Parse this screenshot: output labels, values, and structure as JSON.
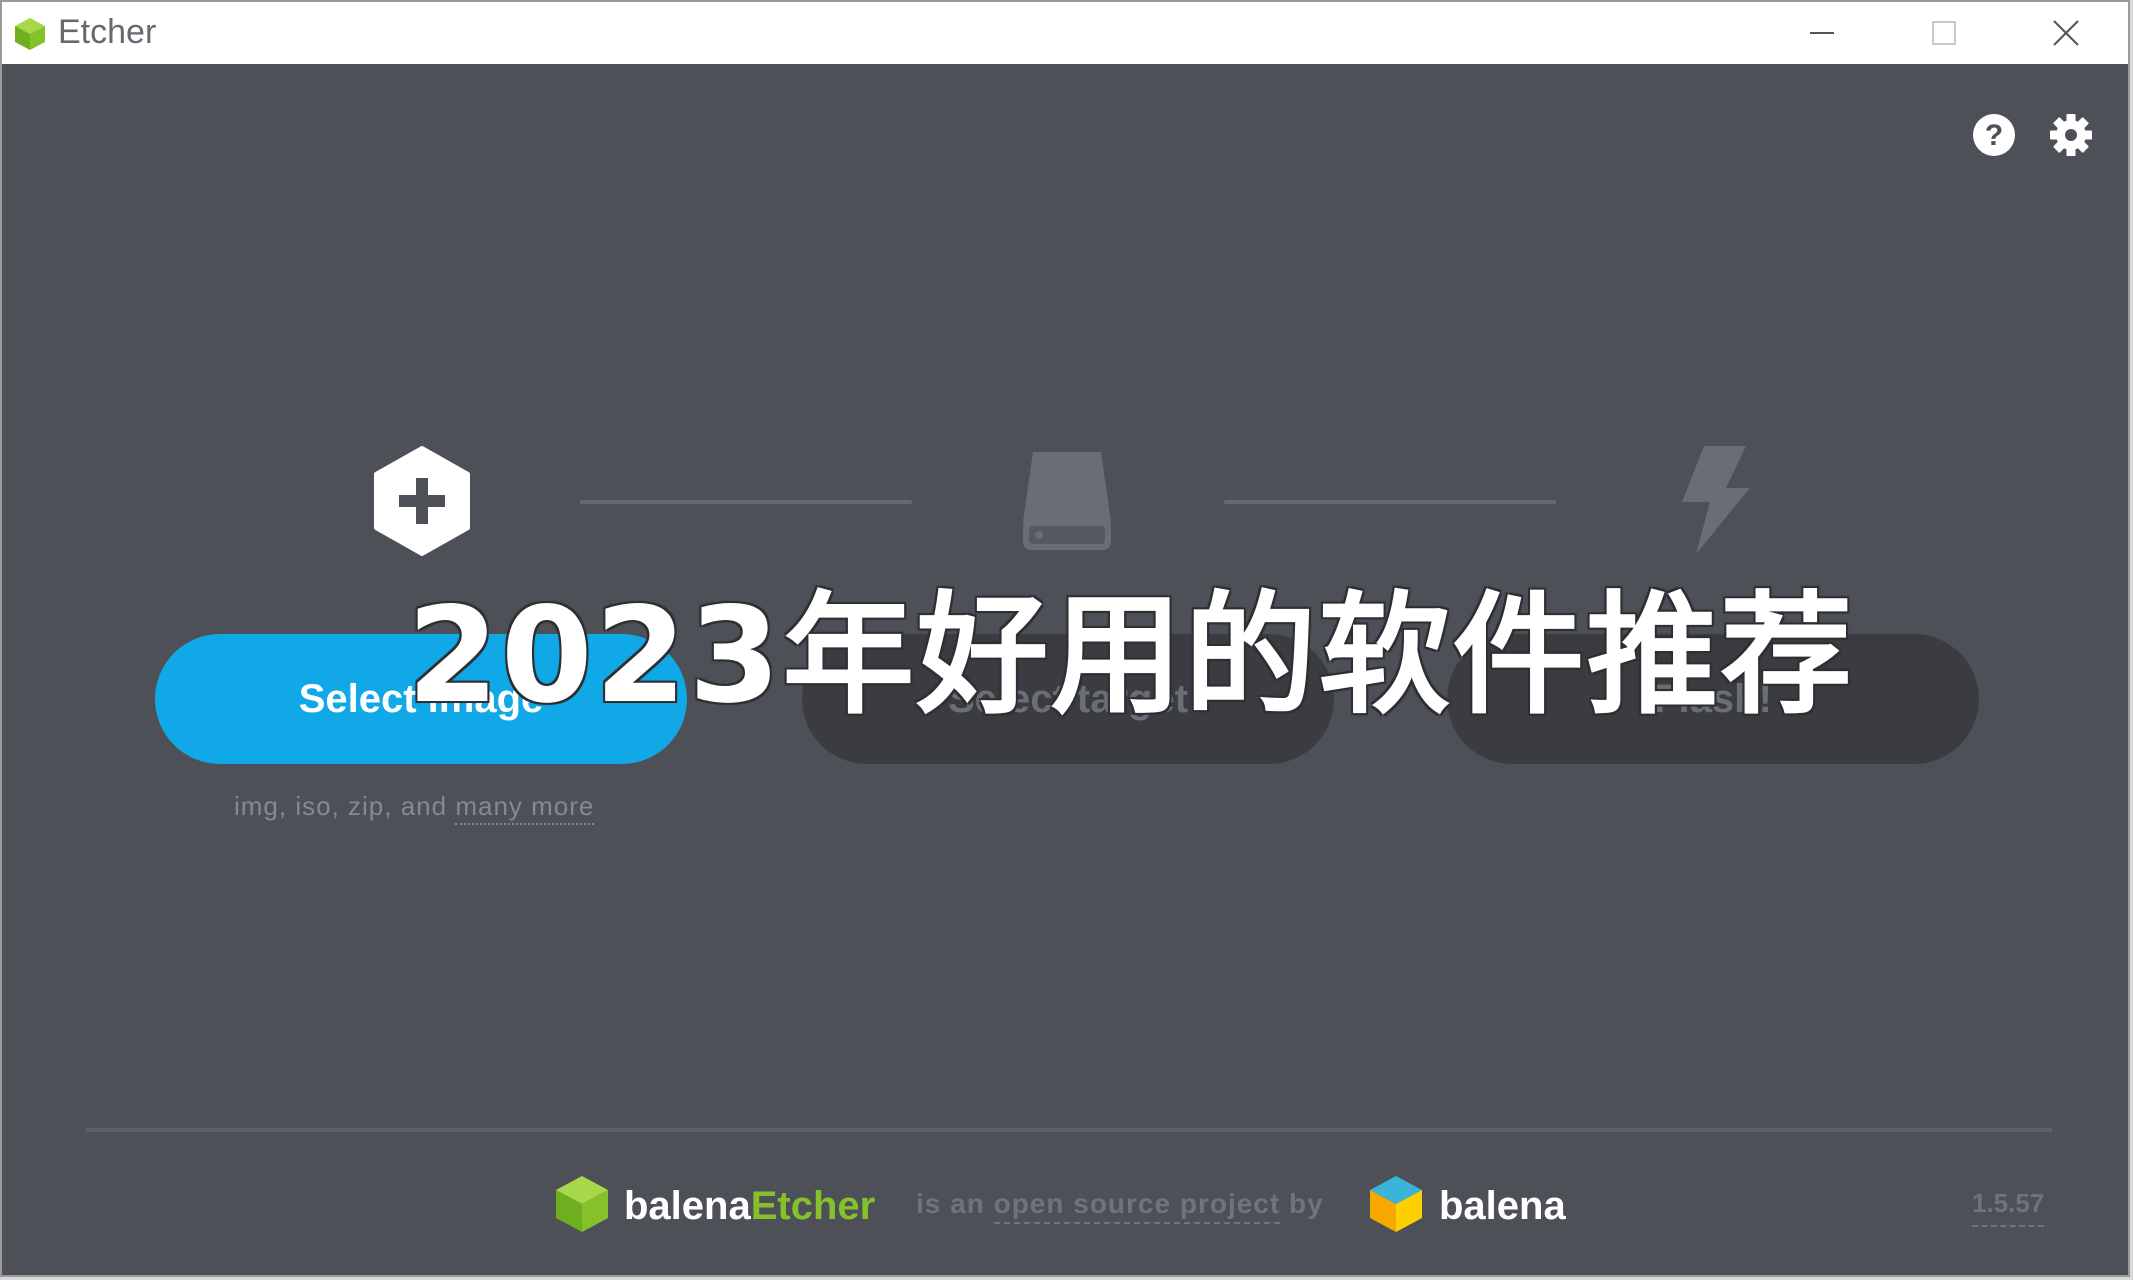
{
  "window": {
    "title": "Etcher",
    "icon": "etcher-cube-icon",
    "controls": [
      "minimize-icon",
      "maximize-icon",
      "close-icon"
    ]
  },
  "header_icons": [
    "help-icon",
    "gear-icon"
  ],
  "steps": [
    {
      "icon": "plus-hexagon-icon",
      "label": "Select image",
      "state": "active"
    },
    {
      "icon": "drive-icon",
      "label": "Select target",
      "state": "disabled"
    },
    {
      "icon": "flash-icon",
      "label": "Flash!",
      "state": "disabled"
    }
  ],
  "hint": {
    "prefix": "img, iso, zip, and",
    "link": "many more"
  },
  "overlay_text": "2023年好用的软件推荐",
  "footer": {
    "brand_prefix": "balena",
    "brand_suffix": "Etcher",
    "tagline_prefix": "is an",
    "tagline_link": "open source project",
    "tagline_suffix": "by",
    "company": "balena",
    "version": "1.5.57"
  },
  "colors": {
    "background": "#4d5057",
    "primary": "#11a8e8",
    "disabled_button": "#3a3c41",
    "etcher_green": "#85c12b"
  }
}
